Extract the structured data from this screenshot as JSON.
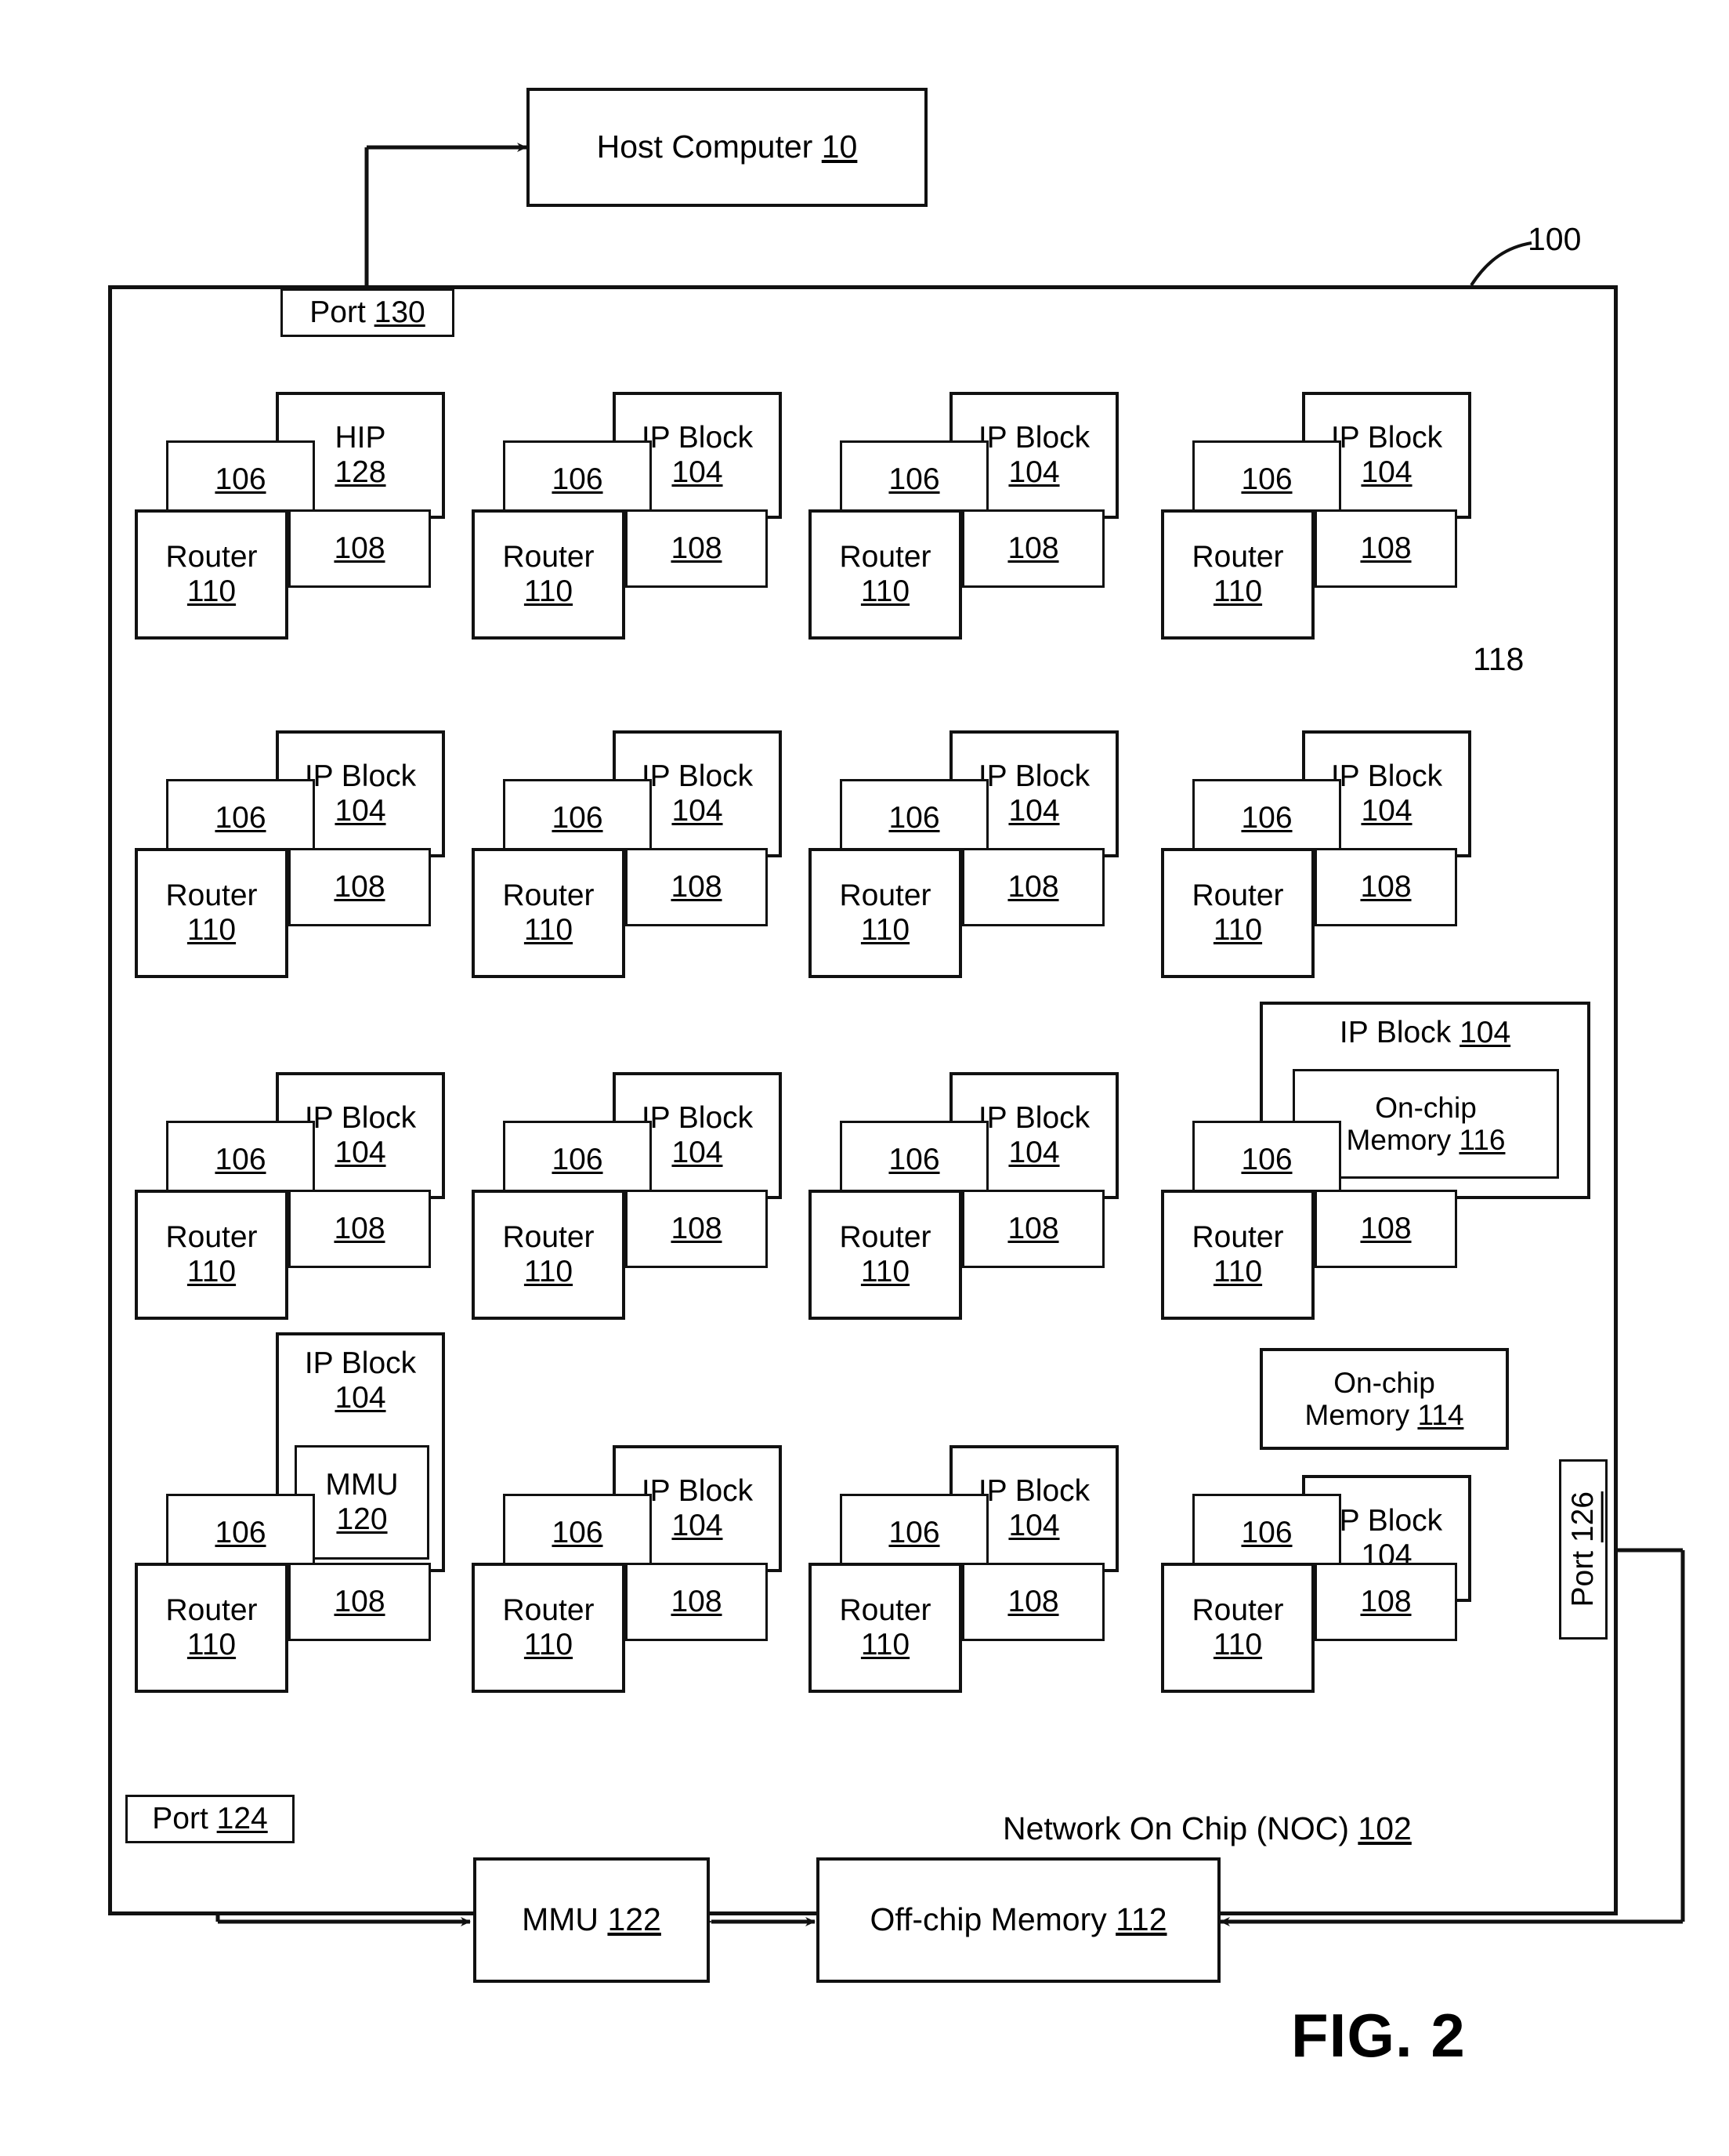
{
  "figure": {
    "caption": "FIG. 2",
    "system_ref": "100"
  },
  "host": {
    "label": "Host Computer",
    "ref": "10"
  },
  "noc": {
    "title": "Network On Chip (NOC)",
    "ref": "102",
    "outer_ref": "100"
  },
  "ports": {
    "top": {
      "label": "Port",
      "ref": "130"
    },
    "bottom_left": {
      "label": "Port",
      "ref": "124"
    },
    "right": {
      "label": "Port",
      "ref": "126"
    }
  },
  "labels": {
    "ip_block": "IP Block",
    "hip": "HIP",
    "router": "Router",
    "on_chip_memory": "On-chip\nMemory",
    "mmu": "MMU",
    "off_chip_memory": "Off-chip  Memory",
    "link_ref": "118"
  },
  "refs": {
    "ip_block": "104",
    "hip": "128",
    "comms_controller": "106",
    "network_interface": "108",
    "router": "110",
    "on_chip_memory_116": "116",
    "on_chip_memory_114": "114",
    "mmu_120": "120",
    "mmu_122": "122",
    "off_chip_memory_112": "112"
  },
  "grid": {
    "rows": 4,
    "cols": 4,
    "cells": [
      {
        "row": 1,
        "col": 1,
        "kind": "hip",
        "title": "HIP",
        "ref": "128",
        "port106": "106",
        "port108": "108",
        "router": "Router",
        "router_ref": "110"
      },
      {
        "row": 1,
        "col": 2,
        "kind": "ip",
        "title": "IP Block",
        "ref": "104",
        "port106": "106",
        "port108": "108",
        "router": "Router",
        "router_ref": "110"
      },
      {
        "row": 1,
        "col": 3,
        "kind": "ip",
        "title": "IP Block",
        "ref": "104",
        "port106": "106",
        "port108": "108",
        "router": "Router",
        "router_ref": "110"
      },
      {
        "row": 1,
        "col": 4,
        "kind": "ip",
        "title": "IP Block",
        "ref": "104",
        "port106": "106",
        "port108": "108",
        "router": "Router",
        "router_ref": "110"
      },
      {
        "row": 2,
        "col": 1,
        "kind": "ip",
        "title": "IP Block",
        "ref": "104",
        "port106": "106",
        "port108": "108",
        "router": "Router",
        "router_ref": "110"
      },
      {
        "row": 2,
        "col": 2,
        "kind": "ip",
        "title": "IP Block",
        "ref": "104",
        "port106": "106",
        "port108": "108",
        "router": "Router",
        "router_ref": "110"
      },
      {
        "row": 2,
        "col": 3,
        "kind": "ip",
        "title": "IP Block",
        "ref": "104",
        "port106": "106",
        "port108": "108",
        "router": "Router",
        "router_ref": "110"
      },
      {
        "row": 2,
        "col": 4,
        "kind": "ip",
        "title": "IP Block",
        "ref": "104",
        "port106": "106",
        "port108": "108",
        "router": "Router",
        "router_ref": "110"
      },
      {
        "row": 3,
        "col": 1,
        "kind": "ip",
        "title": "IP Block",
        "ref": "104",
        "port106": "106",
        "port108": "108",
        "router": "Router",
        "router_ref": "110"
      },
      {
        "row": 3,
        "col": 2,
        "kind": "ip",
        "title": "IP Block",
        "ref": "104",
        "port106": "106",
        "port108": "108",
        "router": "Router",
        "router_ref": "110"
      },
      {
        "row": 3,
        "col": 3,
        "kind": "ip",
        "title": "IP Block",
        "ref": "104",
        "port106": "106",
        "port108": "108",
        "router": "Router",
        "router_ref": "110"
      },
      {
        "row": 3,
        "col": 4,
        "kind": "ip-memory",
        "title": "IP Block",
        "ref": "104",
        "inner_line1": "On-chip",
        "inner_line2": "Memory",
        "inner_ref": "116",
        "port106": "106",
        "port108": "108",
        "router": "Router",
        "router_ref": "110"
      },
      {
        "row": 4,
        "col": 1,
        "kind": "ip-mmu",
        "title": "IP Block",
        "ref": "104",
        "inner_line1": "MMU",
        "inner_ref": "120",
        "port106": "106",
        "port108": "108",
        "router": "Router",
        "router_ref": "110"
      },
      {
        "row": 4,
        "col": 2,
        "kind": "ip",
        "title": "IP Block",
        "ref": "104",
        "port106": "106",
        "port108": "108",
        "router": "Router",
        "router_ref": "110"
      },
      {
        "row": 4,
        "col": 3,
        "kind": "ip",
        "title": "IP Block",
        "ref": "104",
        "port106": "106",
        "port108": "108",
        "router": "Router",
        "router_ref": "110"
      },
      {
        "row": 4,
        "col": 4,
        "kind": "ip-extmem",
        "title": "IP Block",
        "ref": "104",
        "port106": "106",
        "port108": "108",
        "router": "Router",
        "router_ref": "110"
      }
    ]
  },
  "external": {
    "on_chip_memory_114_line1": "On-chip",
    "on_chip_memory_114_line2": "Memory",
    "on_chip_memory_114_ref": "114",
    "mmu_122_label": "MMU",
    "mmu_122_ref": "122",
    "off_chip_label": "Off-chip  Memory",
    "off_chip_ref": "112"
  },
  "colors": {
    "stroke": "#111111",
    "background": "#ffffff"
  }
}
